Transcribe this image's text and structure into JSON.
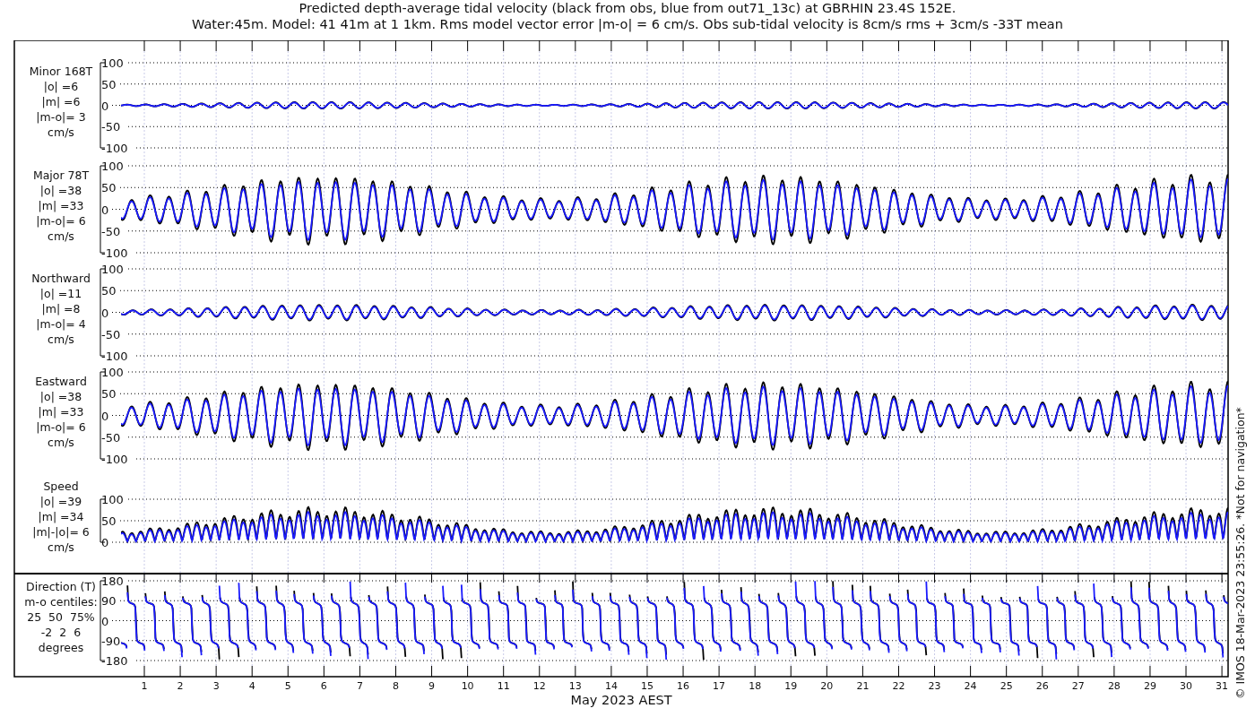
{
  "title_lines": [
    "Predicted depth-average tidal velocity (black from obs, blue from out71_13c) at GBRHIN 23.4S 152E.",
    "Water:45m. Model: 41 41m at 1 1km. Rms model vector error |m-o| = 6 cm/s. Obs sub-tidal velocity is 8cm/s rms + 3cm/s -33T mean"
  ],
  "panels": [
    {
      "kind": "signed",
      "stats": [
        "Minor 168T",
        "|o| =6",
        "|m| =6",
        "|m-o|= 3",
        "cm/s"
      ],
      "yticks": [
        "100",
        "50",
        "0",
        "-50",
        "-100"
      ]
    },
    {
      "kind": "signed",
      "stats": [
        "Major 78T",
        "|o| =38",
        "|m| =33",
        "|m-o|= 6",
        "cm/s"
      ],
      "yticks": [
        "100",
        "50",
        "0",
        "-50",
        "-100"
      ]
    },
    {
      "kind": "signed",
      "stats": [
        "Northward",
        "|o| =11",
        "|m| =8",
        "|m-o|= 4",
        "cm/s"
      ],
      "yticks": [
        "100",
        "50",
        "0",
        "-50",
        "-100"
      ]
    },
    {
      "kind": "signed",
      "stats": [
        "Eastward",
        "|o| =38",
        "|m| =33",
        "|m-o|= 6",
        "cm/s"
      ],
      "yticks": [
        "100",
        "50",
        "0",
        "-50",
        "-100"
      ]
    },
    {
      "kind": "speed",
      "stats": [
        "Speed",
        "|o| =39",
        "|m| =34",
        "|m|-|o|= 6",
        "cm/s"
      ],
      "yticks": [
        "100",
        "50",
        "0"
      ]
    },
    {
      "kind": "direction",
      "stats": [
        "Direction (T)",
        "m-o centiles:",
        "25  50  75%",
        "-2  2  6",
        "degrees"
      ],
      "yticks": [
        "180",
        "90",
        "0",
        "-90",
        "-180"
      ]
    }
  ],
  "x_axis": {
    "ticks": [
      "1",
      "2",
      "3",
      "4",
      "5",
      "6",
      "7",
      "8",
      "9",
      "10",
      "11",
      "12",
      "13",
      "14",
      "15",
      "16",
      "17",
      "18",
      "19",
      "20",
      "21",
      "22",
      "23",
      "24",
      "25",
      "26",
      "27",
      "28",
      "29",
      "30",
      "31"
    ],
    "label": "May 2023 AEST"
  },
  "footer_note": "© IMOS 18-Mar-2023 23:55:26. *Not for navigation*"
}
